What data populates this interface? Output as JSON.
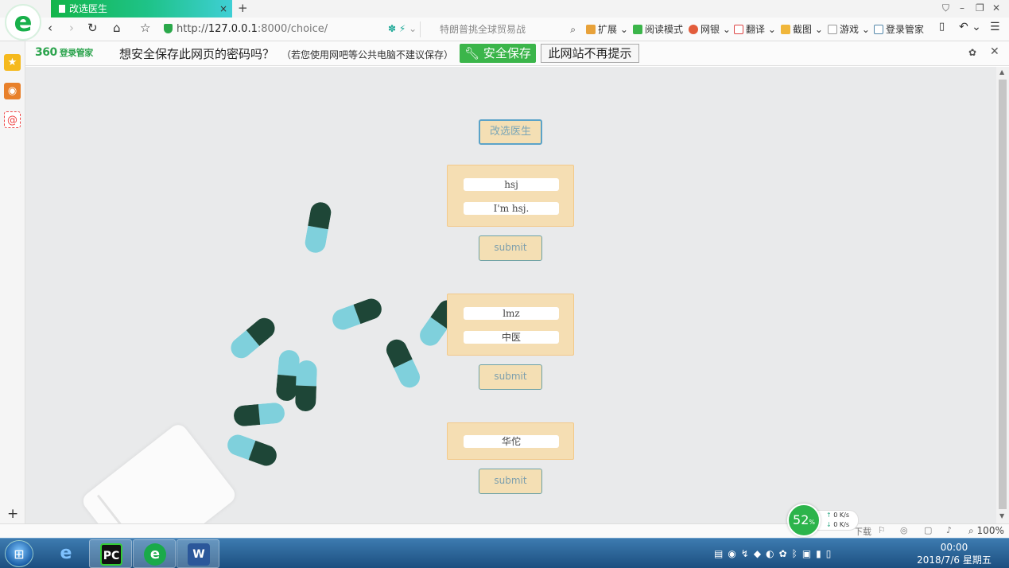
{
  "browser": {
    "tab_title": "改选医生",
    "tab_close": "×",
    "new_tab": "+",
    "url_prefix": "http://",
    "url_host": "127.0.0.1",
    "url_rest": ":8000/choice/",
    "search_placeholder": "特朗普挑全球贸易战",
    "tools": {
      "extend": "扩展",
      "reader": "阅读模式",
      "netbank": "网银",
      "translate": "翻译",
      "screenshot": "截图",
      "games": "游戏",
      "login_manager": "登录管家"
    }
  },
  "password_bar": {
    "brand": "360",
    "brand_sub": "登录管家",
    "question": "想安全保存此网页的密码吗？",
    "note": "（若您使用网吧等公共电脑不建议保存）",
    "save_label": "安全保存",
    "never_label": "此网站不再提示"
  },
  "page": {
    "change_doctor_label": "改选医生",
    "cards": [
      {
        "fields": [
          "hsj",
          "I'm hsj."
        ],
        "submit_label": "submit"
      },
      {
        "fields": [
          "lmz",
          "中医"
        ],
        "submit_label": "submit"
      },
      {
        "fields": [
          "华佗"
        ],
        "submit_label": "submit"
      }
    ]
  },
  "status": {
    "speed_percent": "52",
    "speed_unit": "%",
    "up_rate": "0 K/s",
    "down_rate": "0 K/s",
    "download_label": "下载",
    "zoom": "100%"
  },
  "taskbar": {
    "time": "00:00",
    "date": "2018/7/6 星期五",
    "pycharm_label": "PC",
    "word_label": "W"
  },
  "colors": {
    "browser_green": "#13b54a",
    "card_bg": "#f5deb3",
    "page_bg": "#e9eaeb",
    "save_green": "#3bb54a"
  }
}
